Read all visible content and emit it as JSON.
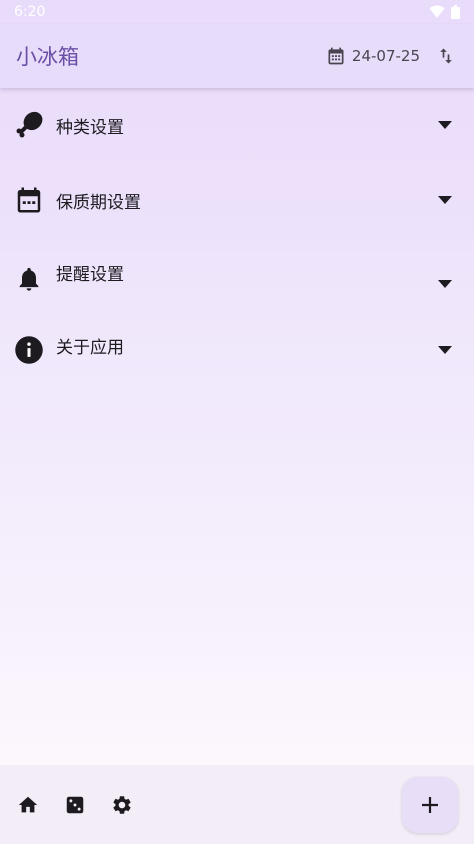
{
  "status_bar": {
    "time": "6:20"
  },
  "app_bar": {
    "title": "小冰箱",
    "date": "24-07-25"
  },
  "sections": [
    {
      "label": "种类设置",
      "icon": "drumstick-icon"
    },
    {
      "label": "保质期设置",
      "icon": "calendar-icon"
    },
    {
      "label": "提醒设置",
      "icon": "bell-icon"
    },
    {
      "label": "关于应用",
      "icon": "info-icon"
    }
  ],
  "bottom_nav": {
    "items": [
      "home-icon",
      "dice-icon",
      "settings-icon"
    ]
  },
  "fab": {
    "label": "+"
  },
  "colors": {
    "app_bar": "#e8dcfb",
    "title": "#6b4fa6",
    "bottom_bar": "#f3edf7",
    "fab": "#e8def8"
  }
}
